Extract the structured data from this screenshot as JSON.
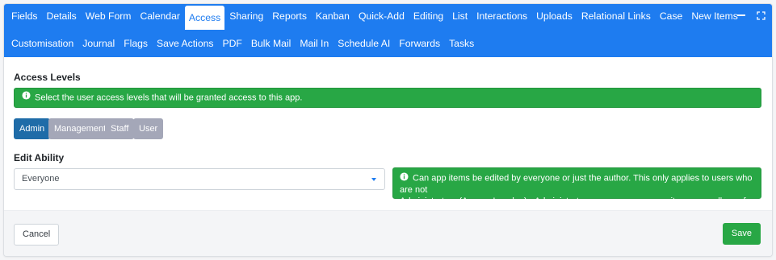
{
  "tabs_row1": [
    "Fields",
    "Details",
    "Web Form",
    "Calendar",
    "Access",
    "Sharing",
    "Reports",
    "Kanban",
    "Quick-Add",
    "Editing",
    "List",
    "Interactions",
    "Uploads",
    "Relational Links",
    "Case",
    "New Items"
  ],
  "tabs_row2": [
    "Customisation",
    "Journal",
    "Flags",
    "Save Actions",
    "PDF",
    "Bulk Mail",
    "Mail In",
    "Schedule AI",
    "Forwards",
    "Tasks"
  ],
  "active_tab": "Access",
  "access_levels": {
    "heading": "Access Levels",
    "info": "Select the user access levels that will be granted access to this app.",
    "buttons": [
      {
        "label": "Admin",
        "selected": true
      },
      {
        "label": "Management",
        "selected": false
      },
      {
        "label": "Staff",
        "selected": false
      },
      {
        "label": "User",
        "selected": false
      }
    ]
  },
  "edit_ability": {
    "heading": "Edit Ability",
    "selected_value": "Everyone",
    "info_line1": "Can app items be edited by everyone or just the author. This only applies to users who are not",
    "info_line2": "Administrators (Access Level: a) - Administrators can see everyones items regardless of this setting."
  },
  "footer": {
    "cancel_label": "Cancel",
    "save_label": "Save"
  },
  "colors": {
    "accent": "#1e7cf0",
    "success": "#28a745",
    "selected_level": "#1f6ca8",
    "unselected_level": "#a4a7b8"
  },
  "icons": {
    "minimize": "minimize-icon",
    "expand": "expand-icon",
    "info": "info-circle-icon"
  }
}
